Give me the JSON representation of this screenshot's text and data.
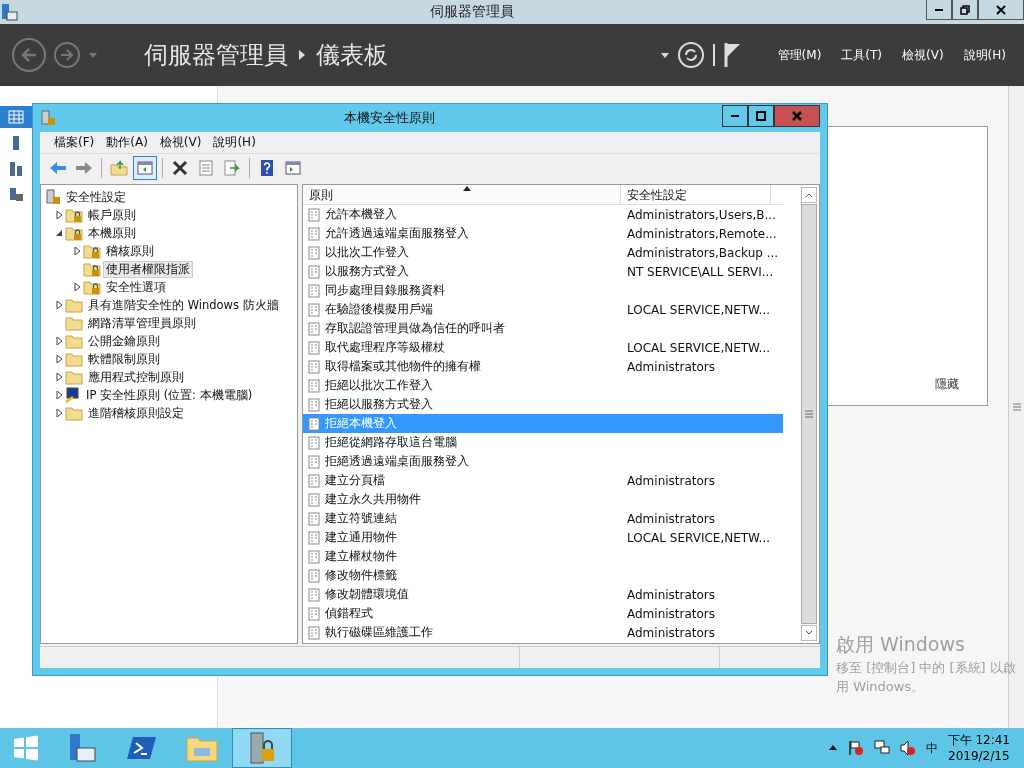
{
  "window": {
    "title": "伺服器管理員"
  },
  "header": {
    "breadcrumb": [
      "伺服器管理員",
      "儀表板"
    ],
    "menus": [
      "管理(M)",
      "工具(T)",
      "檢視(V)",
      "說明(H)"
    ]
  },
  "side_nav": {
    "items": [
      {
        "kind": "dashboard",
        "selected": true
      },
      {
        "kind": "local",
        "selected": false
      },
      {
        "kind": "all",
        "selected": false
      },
      {
        "kind": "files",
        "selected": false
      }
    ]
  },
  "panel": {
    "label": "隱藏"
  },
  "dialog": {
    "title": "本機安全性原則",
    "menu": [
      "檔案(F)",
      "動作(A)",
      "檢視(V)",
      "說明(H)"
    ],
    "toolbar": [
      {
        "kind": "back",
        "pressed": false
      },
      {
        "kind": "forward",
        "pressed": false
      },
      {
        "kind": "up",
        "pressed": false
      },
      {
        "kind": "tree",
        "pressed": true
      },
      {
        "kind": "delete",
        "pressed": false
      },
      {
        "kind": "properties",
        "pressed": false
      },
      {
        "kind": "export",
        "pressed": false
      },
      {
        "kind": "help",
        "pressed": false
      },
      {
        "kind": "pane",
        "pressed": false
      }
    ],
    "tree": [
      {
        "label": "安全性設定",
        "kind": "root",
        "selected": false,
        "children": [
          {
            "label": "帳戶原則",
            "kind": "lock",
            "expanded": false,
            "selected": false
          },
          {
            "label": "本機原則",
            "kind": "lock",
            "expanded": true,
            "selected": false,
            "children": [
              {
                "label": "稽核原則",
                "kind": "lock",
                "expanded": false,
                "selected": false
              },
              {
                "label": "使用者權限指派",
                "kind": "lock",
                "selected": true
              },
              {
                "label": "安全性選項",
                "kind": "lock",
                "expanded": false,
                "selected": false
              }
            ]
          },
          {
            "label": "具有進階安全性的 Windows 防火牆",
            "kind": "folder",
            "expanded": false,
            "selected": false
          },
          {
            "label": "網路清單管理員原則",
            "kind": "folder",
            "selected": false
          },
          {
            "label": "公開金鑰原則",
            "kind": "folder",
            "expanded": false,
            "selected": false
          },
          {
            "label": "軟體限制原則",
            "kind": "folder",
            "expanded": false,
            "selected": false
          },
          {
            "label": "應用程式控制原則",
            "kind": "folder",
            "expanded": false,
            "selected": false
          },
          {
            "label": "IP 安全性原則 (位置: 本機電腦)",
            "kind": "ip",
            "expanded": false,
            "selected": false
          },
          {
            "label": "進階稽核原則設定",
            "kind": "folder",
            "expanded": false,
            "selected": false
          }
        ]
      }
    ],
    "list": {
      "columns": [
        {
          "label": "原則",
          "sorted": true
        },
        {
          "label": "安全性設定",
          "sorted": false
        }
      ],
      "rows": [
        {
          "policy": "允許本機登入",
          "setting": "Administrators,Users,B...",
          "selected": false
        },
        {
          "policy": "允許透過遠端桌面服務登入",
          "setting": "Administrators,Remote...",
          "selected": false
        },
        {
          "policy": "以批次工作登入",
          "setting": "Administrators,Backup ...",
          "selected": false
        },
        {
          "policy": "以服務方式登入",
          "setting": "NT SERVICE\\ALL SERVI...",
          "selected": false
        },
        {
          "policy": "同步處理目錄服務資料",
          "selected": false
        },
        {
          "policy": "在驗證後模擬用戶端",
          "setting": "LOCAL SERVICE,NETW...",
          "selected": false
        },
        {
          "policy": "存取認證管理員做為信任的呼叫者",
          "selected": false
        },
        {
          "policy": "取代處理程序等級權杖",
          "setting": "LOCAL SERVICE,NETW...",
          "selected": false
        },
        {
          "policy": "取得檔案或其他物件的擁有權",
          "setting": "Administrators",
          "selected": false
        },
        {
          "policy": "拒絕以批次工作登入",
          "selected": false
        },
        {
          "policy": "拒絕以服務方式登入",
          "selected": false
        },
        {
          "policy": "拒絕本機登入",
          "selected": true
        },
        {
          "policy": "拒絕從網路存取這台電腦",
          "selected": false
        },
        {
          "policy": "拒絕透過遠端桌面服務登入",
          "selected": false
        },
        {
          "policy": "建立分頁檔",
          "setting": "Administrators",
          "selected": false
        },
        {
          "policy": "建立永久共用物件",
          "selected": false
        },
        {
          "policy": "建立符號連結",
          "setting": "Administrators",
          "selected": false
        },
        {
          "policy": "建立通用物件",
          "setting": "LOCAL SERVICE,NETW...",
          "selected": false
        },
        {
          "policy": "建立權杖物件",
          "selected": false
        },
        {
          "policy": "修改物件標籤",
          "selected": false
        },
        {
          "policy": "修改韌體環境值",
          "setting": "Administrators",
          "selected": false
        },
        {
          "policy": "偵錯程式",
          "setting": "Administrators",
          "selected": false
        },
        {
          "policy": "執行磁碟區維護工作",
          "setting": "Administrators",
          "selected": false
        }
      ]
    }
  },
  "activation": {
    "title": "啟用 Windows",
    "message": "移至 [控制台] 中的 [系統] 以啟用 Windows。"
  },
  "taskbar": {
    "apps": [
      {
        "kind": "start",
        "selected": false
      },
      {
        "kind": "server",
        "selected": false
      },
      {
        "kind": "shell",
        "selected": false
      },
      {
        "kind": "explorer",
        "selected": false
      },
      {
        "kind": "policy",
        "selected": true
      }
    ],
    "ime": "中",
    "time": "下午 12:41",
    "date": "2019/2/15"
  }
}
